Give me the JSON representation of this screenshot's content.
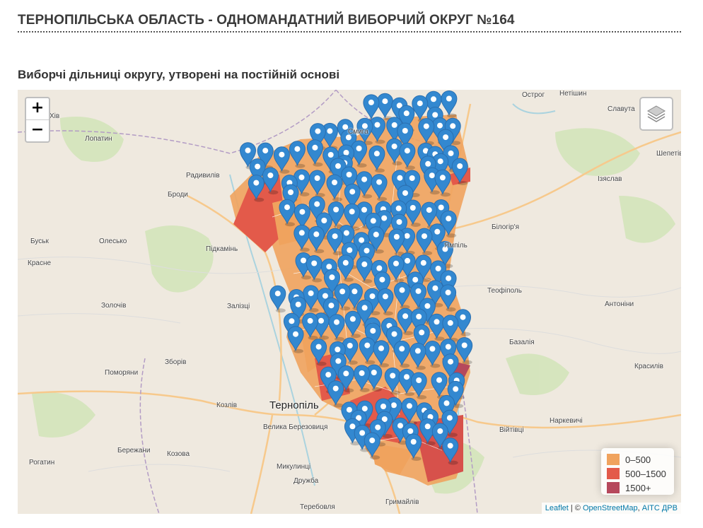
{
  "header": {
    "title": "ТЕРНОПІЛЬСЬКА ОБЛАСТЬ - ОДНОМАНДАТНИЙ ВИБОРЧИЙ ОКРУГ №164",
    "subtitle": "Виборчі дільниці округу, утворені на постійній основі"
  },
  "map": {
    "zoom_in_label": "+",
    "zoom_out_label": "−",
    "layers_icon": "layers-icon",
    "marker_icon": "map-marker-icon",
    "place_labels": {
      "ternopil": "Тернопіль",
      "lopatyn": "Лопатин",
      "radyviliv": "Радивилів",
      "brody": "Броди",
      "busk": "Буськ",
      "olesko": "Олесько",
      "pidkamin": "Підкамінь",
      "krasne": "Красне",
      "zolochiv": "Золочів",
      "zalistsi": "Залізці",
      "zboriv": "Зборів",
      "pomoriany": "Поморяни",
      "kozliv": "Козлів",
      "velyka_berezovytsia": "Велика Березовиця",
      "berezhany": "Бережани",
      "kozova": "Козова",
      "rohatyn": "Рогатин",
      "mykulyntsi": "Микулинці",
      "druzhba": "Дружба",
      "terebovlia": "Теребовля",
      "hrymailiv": "Гримайлів",
      "ostroh": "Острог",
      "netishyn": "Нетішин",
      "slavuta": "Славута",
      "shepetivka": "Шепетів",
      "iziaslav": "Ізяслав",
      "bilohiria": "Білогір'я",
      "yampil": "Ямпіль",
      "teofipol": "Теофіполь",
      "antonyny": "Антоніни",
      "bazaliia": "Базалія",
      "krasyliv": "Красилів",
      "vityvtsi": "Війтівці",
      "narkevychi": "Наркевичі",
      "smyha": "Смига",
      "khiv": "Хів"
    },
    "legend": {
      "items": [
        {
          "label": "0–500",
          "color": "#f0a35e"
        },
        {
          "label": "500–1500",
          "color": "#e35a4a"
        },
        {
          "label": "1500+",
          "color": "#b6485c"
        }
      ]
    },
    "attribution": {
      "leaflet": "Leaflet",
      "sep": " | © ",
      "osm": "OpenStreetMap",
      "comma": ", ",
      "drv": "АІТС ДРВ"
    },
    "colors": {
      "marker": "#3388d0",
      "marker_stroke": "#2a6fb0"
    }
  }
}
